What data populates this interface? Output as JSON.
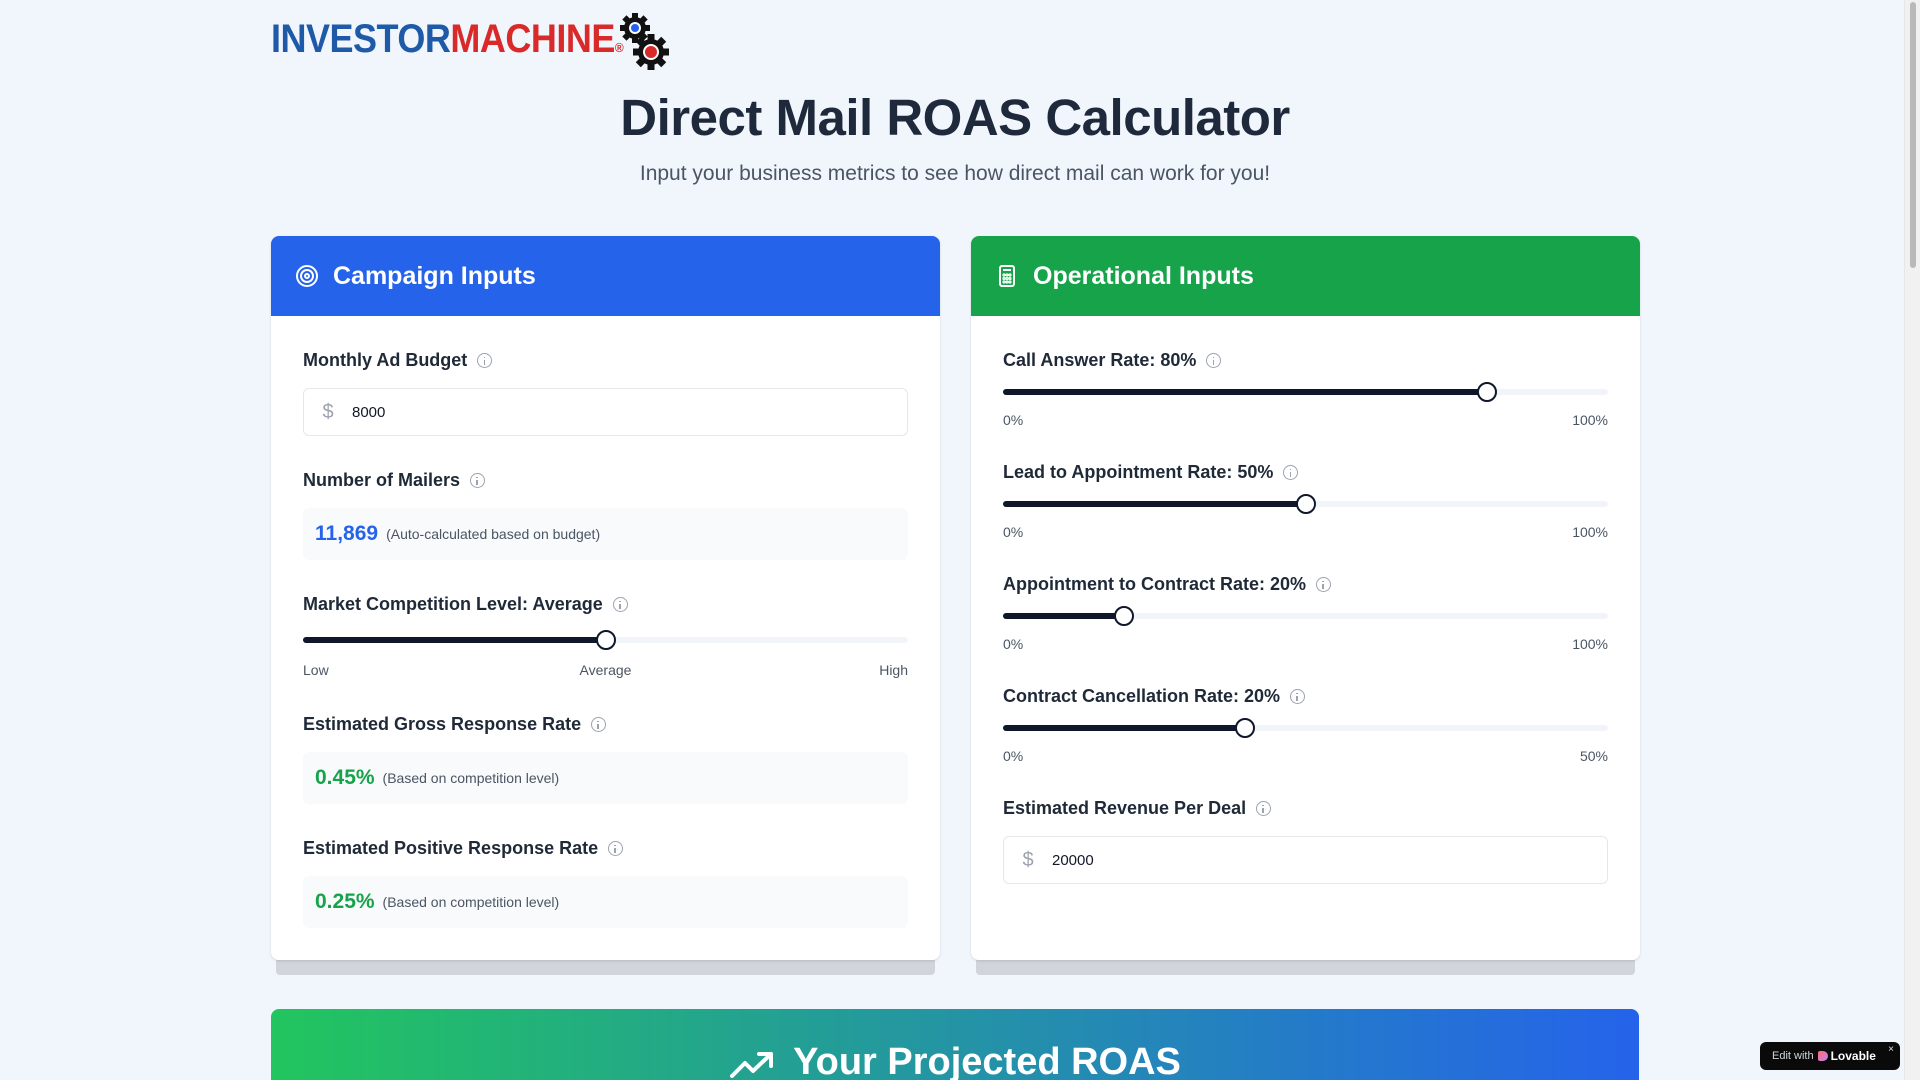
{
  "brand": {
    "logo_part1": "INVESTOR",
    "logo_part2": "MACHINE",
    "logo_mark": "®"
  },
  "page": {
    "title": "Direct Mail ROAS Calculator",
    "subtitle": "Input your business metrics to see how direct mail can work for you!"
  },
  "campaign": {
    "header": "Campaign Inputs",
    "header_icon": "target-icon",
    "budget_label": "Monthly Ad Budget",
    "budget_currency": "$",
    "budget_value": "8000",
    "mailers_label": "Number of Mailers",
    "mailers_value": "11,869",
    "mailers_note": "(Auto-calculated based on budget)",
    "competition_label": "Market Competition Level: Average",
    "competition_level": 0.5,
    "competition_scale": [
      "Low",
      "Average",
      "High"
    ],
    "gross_label": "Estimated Gross Response Rate",
    "gross_value": "0.45%",
    "gross_note": "(Based on competition level)",
    "positive_label": "Estimated Positive Response Rate",
    "positive_value": "0.25%",
    "positive_note": "(Based on competition level)"
  },
  "operational": {
    "header": "Operational Inputs",
    "header_icon": "calculator-icon",
    "answer_label": "Call Answer Rate: 80%",
    "answer_value": 80,
    "answer_min": "0%",
    "answer_max": "100%",
    "appt_label": "Lead to Appointment Rate: 50%",
    "appt_value": 50,
    "appt_min": "0%",
    "appt_max": "100%",
    "contract_label": "Appointment to Contract Rate: 20%",
    "contract_value": 20,
    "contract_min": "0%",
    "contract_max": "100%",
    "cancel_label": "Contract Cancellation Rate: 20%",
    "cancel_value": 20,
    "cancel_range_max": 50,
    "cancel_min": "0%",
    "cancel_max": "50%",
    "revenue_label": "Estimated Revenue Per Deal",
    "revenue_currency": "$",
    "revenue_value": "20000"
  },
  "results": {
    "title": "Your Projected ROAS",
    "icon": "trending-up-icon"
  },
  "badge": {
    "edit": "Edit with",
    "brand": "Lovable",
    "close": "×"
  },
  "colors": {
    "campaign_header": "#2563eb",
    "operational_header": "#16a34a",
    "accent_blue": "#2563eb",
    "accent_green": "#16a34a"
  }
}
